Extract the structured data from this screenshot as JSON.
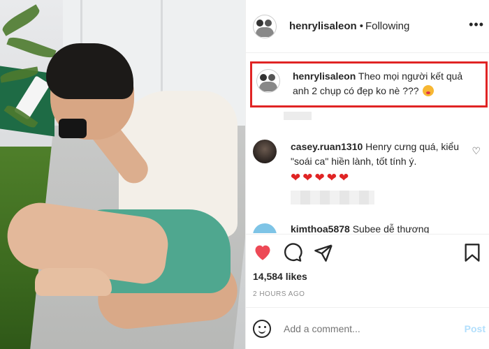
{
  "photo": {
    "description_alt": ""
  },
  "header": {
    "username": "henrylisaleon",
    "separator": "•",
    "follow_status": "Following",
    "more_icon": "more-horizontal-icon"
  },
  "caption": {
    "username": "henrylisaleon",
    "text": "Theo mọi người kết quả anh 2 chụp có đẹp ko nè ???",
    "emoji": "kissing-face-emoji",
    "highlight_color": "#e02424"
  },
  "comments": [
    {
      "username": "casey.ruan1310",
      "text": "Henry cưng quá, kiểu \"soái ca\" hiền lành, tốt tính ý.",
      "hearts": "❤❤❤❤❤"
    },
    {
      "username": "kimthoa5878",
      "text": "Subee dễ thương"
    }
  ],
  "actions": {
    "like_icon": "heart-filled-icon",
    "comment_icon": "comment-bubble-icon",
    "share_icon": "paper-plane-icon",
    "save_icon": "bookmark-icon",
    "like_color": "#ed4956"
  },
  "likes": "14,584 likes",
  "time_ago": "2 HOURS AGO",
  "add_comment": {
    "placeholder": "Add a comment...",
    "post_label": "Post"
  }
}
